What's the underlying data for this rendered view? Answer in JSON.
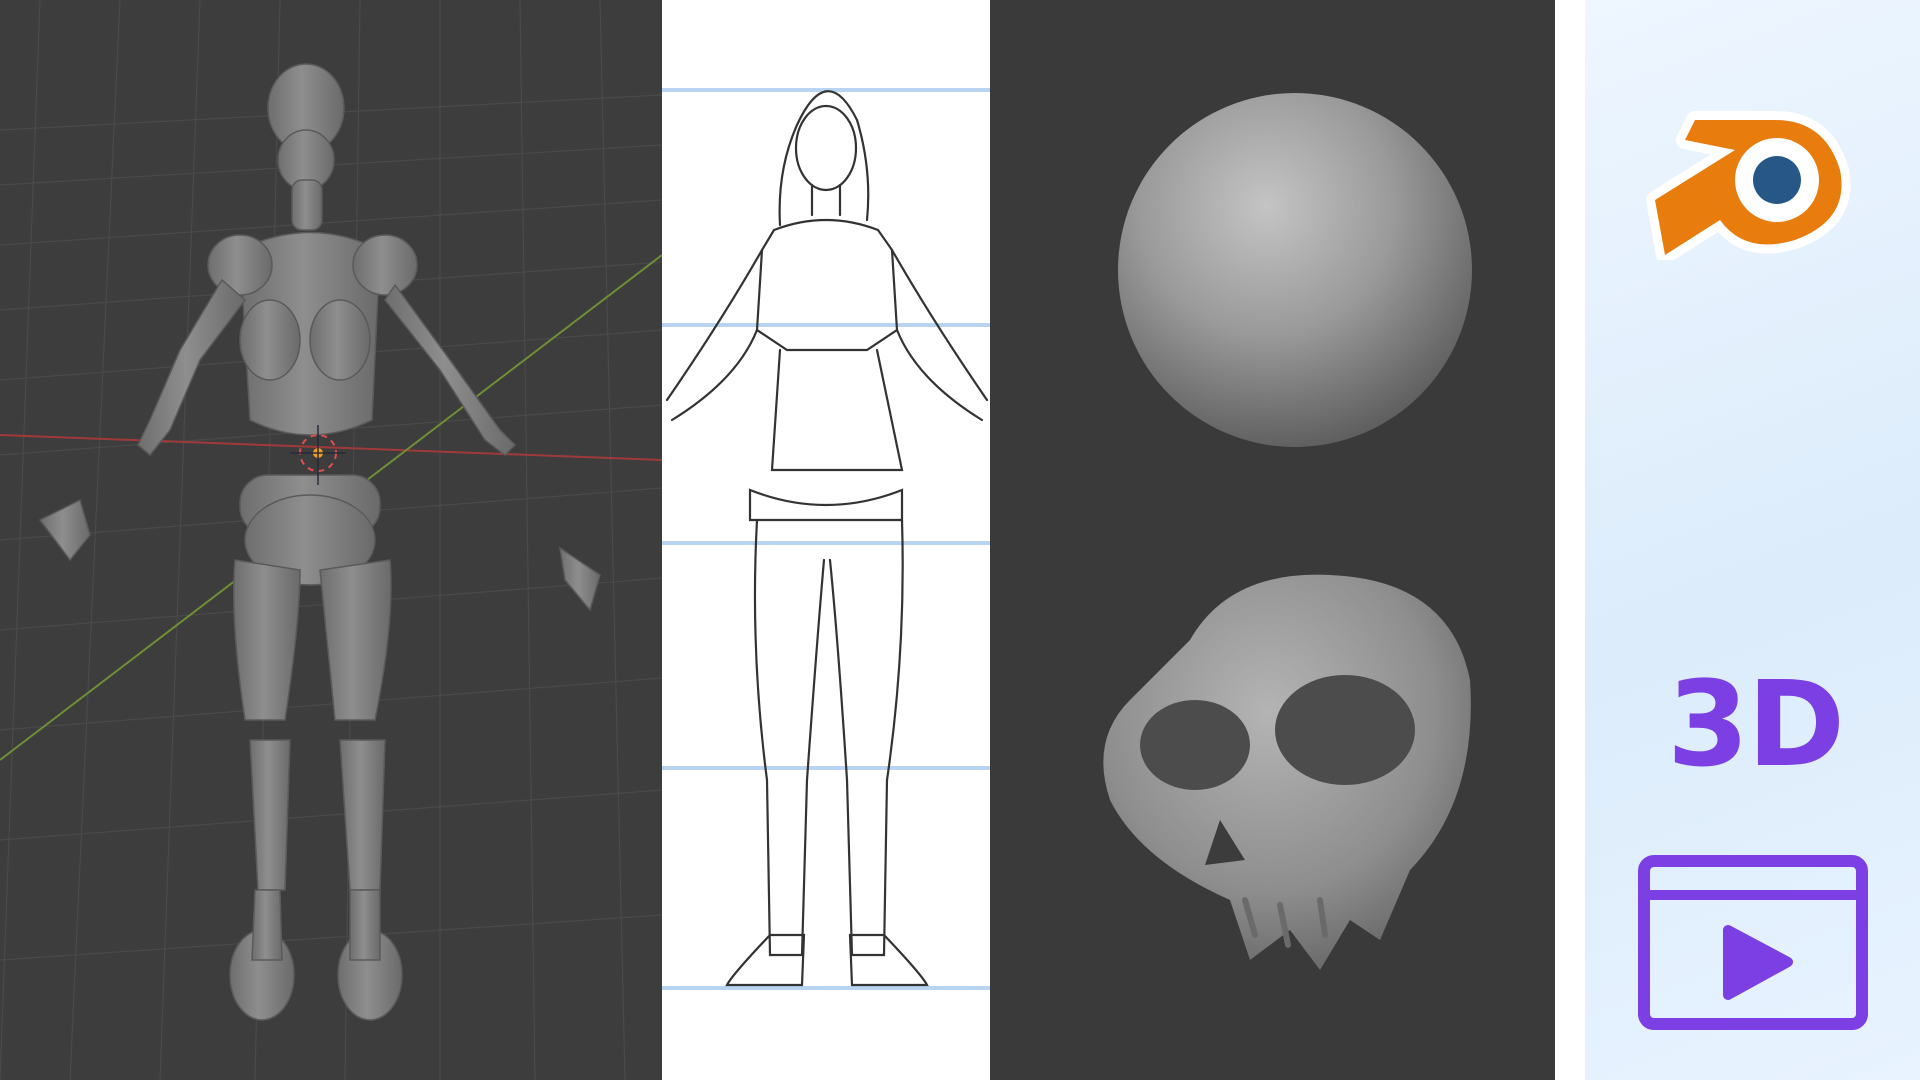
{
  "panels": {
    "viewport": {
      "name": "3d-viewport",
      "subject": "mannequin-figure"
    },
    "sketch": {
      "name": "character-sketch"
    },
    "sculpt": {
      "name": "sculpt-panel",
      "items": [
        "sphere",
        "skull"
      ]
    }
  },
  "sidebar": {
    "logo_icon": "blender-logo-icon",
    "label": "3D",
    "video_icon": "video-play-icon",
    "accent_color": "#7b3fe4",
    "logo_colors": {
      "orange": "#e87d0d",
      "blue": "#265787"
    }
  }
}
